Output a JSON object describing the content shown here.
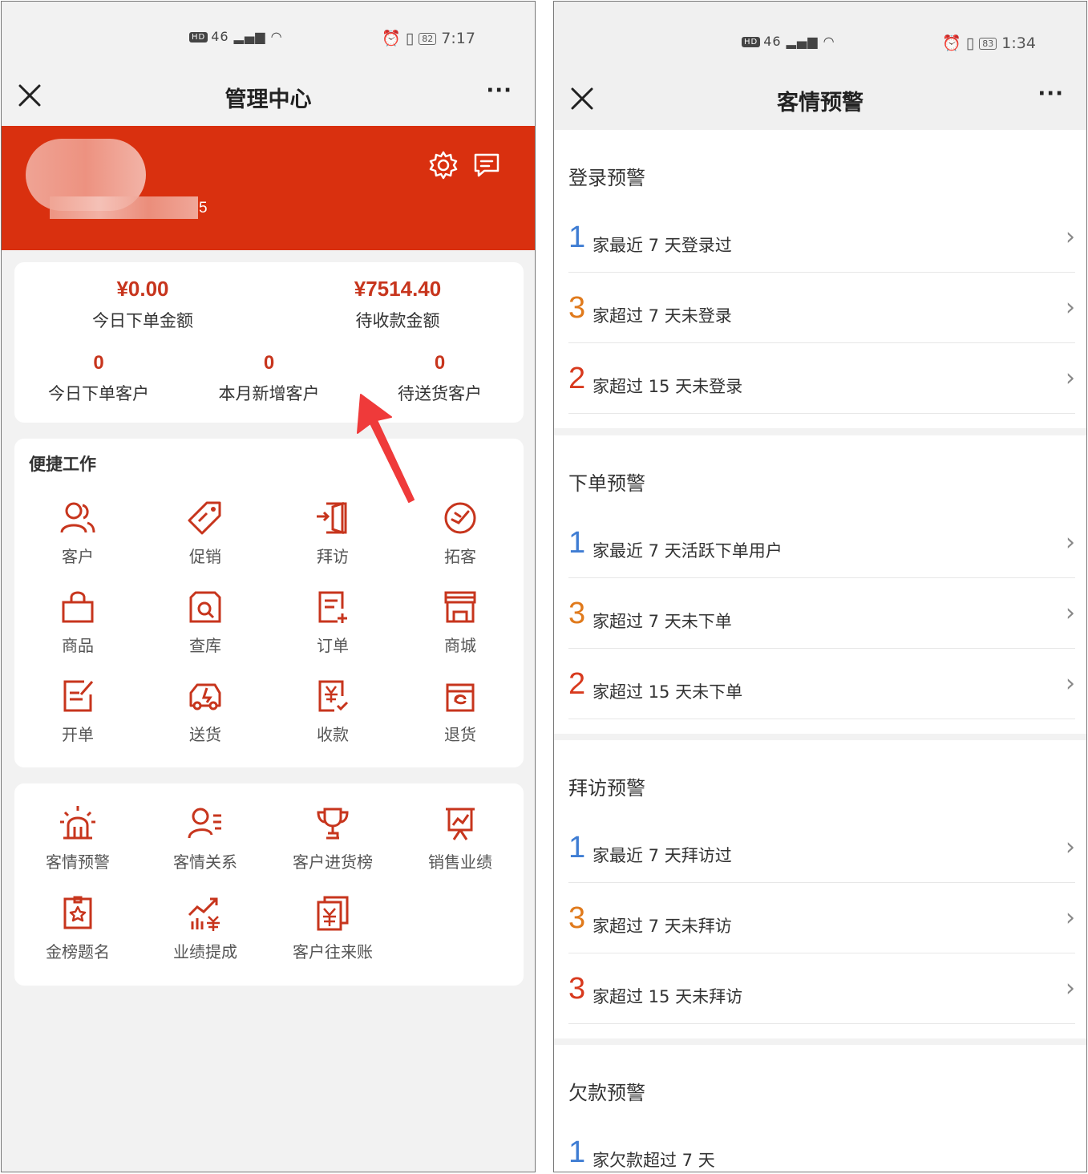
{
  "left": {
    "status": {
      "signal": "46",
      "time": "7:17",
      "battery": "82"
    },
    "nav": {
      "title": "管理中心",
      "more": "···"
    },
    "band": {
      "user_suffix": "5"
    },
    "stats": {
      "today_order_amount": {
        "value": "¥0.00",
        "label": "今日下单金额"
      },
      "pending_collection": {
        "value": "¥7514.40",
        "label": "待收款金额"
      },
      "today_order_customers": {
        "value": "0",
        "label": "今日下单客户"
      },
      "month_new_customers": {
        "value": "0",
        "label": "本月新增客户"
      },
      "pending_delivery": {
        "value": "0",
        "label": "待送货客户"
      }
    },
    "quick_work": {
      "title": "便捷工作",
      "items": [
        {
          "label": "客户",
          "icon": "customer-icon"
        },
        {
          "label": "促销",
          "icon": "promotion-tag-icon"
        },
        {
          "label": "拜访",
          "icon": "visit-door-icon"
        },
        {
          "label": "拓客",
          "icon": "expand-customer-icon"
        },
        {
          "label": "商品",
          "icon": "shopping-bag-icon"
        },
        {
          "label": "查库",
          "icon": "inventory-search-icon"
        },
        {
          "label": "订单",
          "icon": "order-list-icon"
        },
        {
          "label": "商城",
          "icon": "store-icon"
        },
        {
          "label": "开单",
          "icon": "create-order-icon"
        },
        {
          "label": "送货",
          "icon": "delivery-truck-icon"
        },
        {
          "label": "收款",
          "icon": "collect-payment-icon"
        },
        {
          "label": "退货",
          "icon": "return-goods-icon"
        }
      ]
    },
    "more_tools": {
      "items": [
        {
          "label": "客情预警",
          "icon": "alarm-light-icon"
        },
        {
          "label": "客情关系",
          "icon": "relationship-icon"
        },
        {
          "label": "客户进货榜",
          "icon": "trophy-icon"
        },
        {
          "label": "销售业绩",
          "icon": "sales-chart-icon"
        },
        {
          "label": "金榜题名",
          "icon": "honor-board-icon"
        },
        {
          "label": "业绩提成",
          "icon": "commission-icon"
        },
        {
          "label": "客户往来账",
          "icon": "ledger-icon"
        }
      ]
    },
    "colors": {
      "accent": "#d9300f",
      "icon": "#c7351d"
    }
  },
  "right": {
    "status": {
      "signal": "46",
      "time": "1:34",
      "battery": "83"
    },
    "nav": {
      "title": "客情预警",
      "more": "···"
    },
    "sections": [
      {
        "title": "登录预警",
        "rows": [
          {
            "num": "1",
            "text": "家最近 7 天登录过",
            "color": "blue"
          },
          {
            "num": "3",
            "text": "家超过 7 天未登录",
            "color": "orange"
          },
          {
            "num": "2",
            "text": "家超过 15 天未登录",
            "color": "red"
          }
        ]
      },
      {
        "title": "下单预警",
        "rows": [
          {
            "num": "1",
            "text": "家最近 7 天活跃下单用户",
            "color": "blue"
          },
          {
            "num": "3",
            "text": "家超过 7 天未下单",
            "color": "orange"
          },
          {
            "num": "2",
            "text": "家超过 15 天未下单",
            "color": "red"
          }
        ]
      },
      {
        "title": "拜访预警",
        "rows": [
          {
            "num": "1",
            "text": "家最近 7 天拜访过",
            "color": "blue"
          },
          {
            "num": "3",
            "text": "家超过 7 天未拜访",
            "color": "orange"
          },
          {
            "num": "3",
            "text": "家超过 15 天未拜访",
            "color": "red"
          }
        ]
      },
      {
        "title": "欠款预警",
        "rows": [
          {
            "num": "1",
            "text": "家欠款超过 7 天",
            "color": "blue"
          }
        ]
      }
    ],
    "chevron": "›",
    "colors": {
      "blue": "#3f7dd3",
      "orange": "#e07a1c",
      "red": "#d83a1e"
    }
  }
}
